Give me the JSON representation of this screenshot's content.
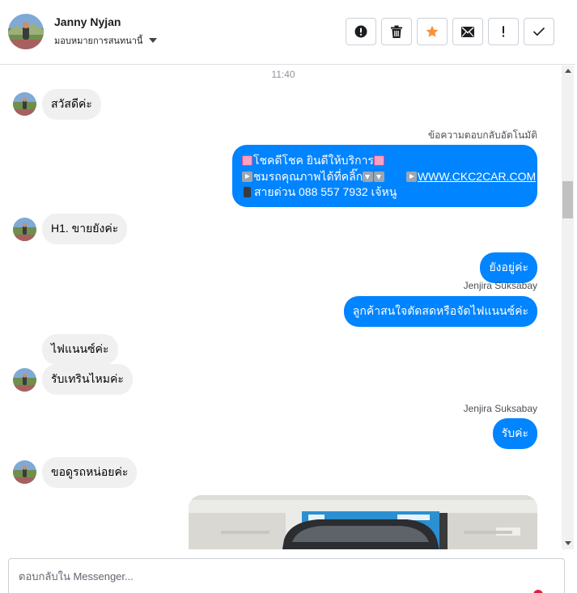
{
  "header": {
    "name": "Janny Nyjan",
    "assign_label": "มอบหมายการสนทนานี้",
    "toolbar": [
      {
        "id": "spam",
        "icon": "alert-circle-icon"
      },
      {
        "id": "delete",
        "icon": "trash-icon"
      },
      {
        "id": "star",
        "icon": "star-icon"
      },
      {
        "id": "unread",
        "icon": "envelope-icon"
      },
      {
        "id": "important",
        "icon": "exclamation-icon"
      },
      {
        "id": "done",
        "icon": "check-icon"
      }
    ]
  },
  "conversation": {
    "timestamp": "11:40",
    "messages": {
      "m1": "สวัสดีค่ะ",
      "auto_label": "ข้อความตอบกลับอัตโนมัติ",
      "auto_line1": "โชคดีโชค ยินดีให้บริการ",
      "auto_line2_text": "ชมรถคุณภาพได้ที่คลิ๊ก",
      "auto_line2_link": "WWW.CKC2CAR.COM",
      "auto_line3": "สายด่วน 088 557 7932 เจ้หนู",
      "m2": "H1. ขายยังค่ะ",
      "m3": "ยังอยู่ค่ะ",
      "sender1": "Jenjira Suksabay",
      "m4": "ลูกค้าสนใจตัดสดหรือจัดไฟแนนซ์ค่ะ",
      "m5": "ไฟแนนซ์ค่ะ",
      "m6": "รับเทรินไหมค่ะ",
      "sender2": "Jenjira Suksabay",
      "m7": "รับค่ะ",
      "m8": "ขอดูรถหน่อยค่ะ"
    }
  },
  "composer": {
    "placeholder": "ตอบกลับใน Messenger..."
  },
  "colors": {
    "outgoing_bubble": "#0084ff",
    "incoming_bubble": "#f0f0f0",
    "star": "#f7923b"
  }
}
